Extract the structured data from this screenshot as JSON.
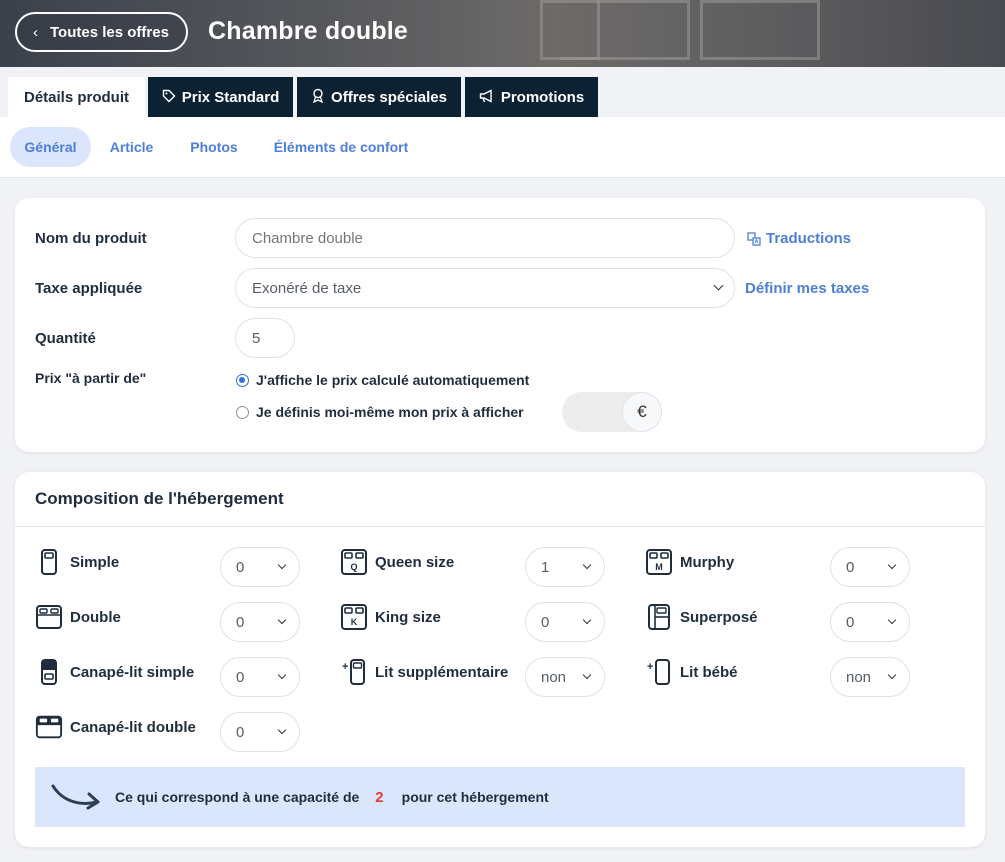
{
  "header": {
    "back_label": "Toutes les offres",
    "title": "Chambre double"
  },
  "tabs": [
    {
      "label": "Détails produit",
      "icon": "none",
      "active": true
    },
    {
      "label": "Prix Standard",
      "icon": "tag-icon",
      "active": false
    },
    {
      "label": "Offres spéciales",
      "icon": "award-icon",
      "active": false
    },
    {
      "label": "Promotions",
      "icon": "megaphone-icon",
      "active": false
    }
  ],
  "subtabs": [
    {
      "label": "Général",
      "active": true
    },
    {
      "label": "Article",
      "active": false
    },
    {
      "label": "Photos",
      "active": false
    },
    {
      "label": "Éléments de confort",
      "active": false
    }
  ],
  "product": {
    "name_label": "Nom du produit",
    "name_placeholder": "Chambre double",
    "translations_link": "Traductions",
    "tax_label": "Taxe appliquée",
    "tax_value": "Exonéré de taxe",
    "define_taxes_link": "Définir mes taxes",
    "quantity_label": "Quantité",
    "quantity_value": "5",
    "price_from_label": "Prix \"à partir de\"",
    "radio_auto": "J'affiche le prix calculé automatiquement",
    "radio_manual": "Je définis moi-même mon prix à afficher",
    "currency_symbol": "€"
  },
  "composition": {
    "title": "Composition de l'hébergement",
    "beds": [
      {
        "label": "Simple",
        "value": "0",
        "icon": "single-bed-icon"
      },
      {
        "label": "Queen size",
        "value": "1",
        "icon": "queen-bed-icon"
      },
      {
        "label": "Murphy",
        "value": "0",
        "icon": "murphy-bed-icon"
      },
      {
        "label": "Double",
        "value": "0",
        "icon": "double-bed-icon"
      },
      {
        "label": "King size",
        "value": "0",
        "icon": "king-bed-icon"
      },
      {
        "label": "Superposé",
        "value": "0",
        "icon": "bunk-bed-icon"
      },
      {
        "label": "Canapé-lit simple",
        "value": "0",
        "icon": "single-sofa-bed-icon"
      },
      {
        "label": "Lit supplémentaire",
        "value": "non",
        "icon": "extra-bed-icon"
      },
      {
        "label": "Lit bébé",
        "value": "non",
        "icon": "baby-bed-icon"
      },
      {
        "label": "Canapé-lit double",
        "value": "0",
        "icon": "double-sofa-bed-icon"
      }
    ],
    "capacity_prefix": "Ce qui correspond à une capacité de",
    "capacity_value": "2",
    "capacity_suffix": "pour cet hébergement"
  },
  "colors": {
    "navy": "#0c2233",
    "accent_blue": "#4d7fd8",
    "capacity_bg": "#dbe5fb",
    "capacity_number": "#e53935"
  }
}
